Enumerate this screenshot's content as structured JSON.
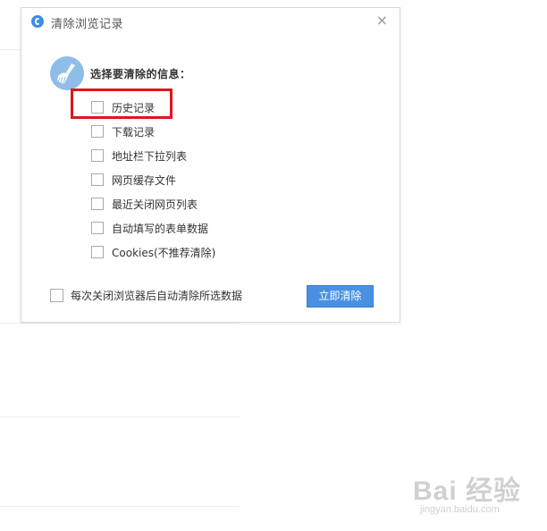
{
  "dialog": {
    "title": "清除浏览记录",
    "close_symbol": "×",
    "heading": "选择要清除的信息：",
    "options": [
      {
        "label": "历史记录",
        "checked": false,
        "highlighted": true
      },
      {
        "label": "下载记录",
        "checked": false
      },
      {
        "label": "地址栏下拉列表",
        "checked": false
      },
      {
        "label": "网页缓存文件",
        "checked": false
      },
      {
        "label": "最近关闭网页列表",
        "checked": false
      },
      {
        "label": "自动填写的表单数据",
        "checked": false
      },
      {
        "label": "Cookies(不推荐清除)",
        "checked": false
      }
    ],
    "auto_clear_label": "每次关闭浏览器后自动清除所选数据",
    "clear_button": "立即清除"
  },
  "colors": {
    "highlight_border": "#e2141c",
    "button_blue": "#4a90e2",
    "broom_icon_bg": "#8dbde8"
  },
  "watermark": {
    "main": "Bai 经验",
    "sub": "jingyan.baidu.com"
  }
}
